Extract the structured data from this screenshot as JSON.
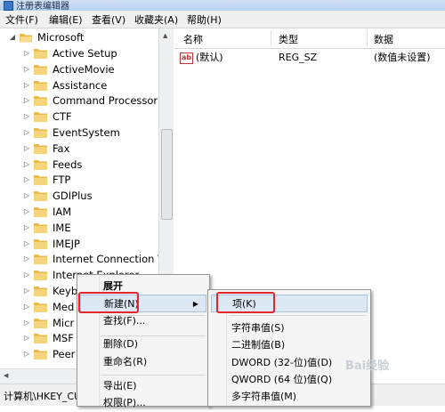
{
  "window": {
    "title": "注册表编辑器"
  },
  "menubar": [
    "文件(F)",
    "编辑(E)",
    "查看(V)",
    "收藏夹(A)",
    "帮助(H)"
  ],
  "tree": {
    "root": "Microsoft",
    "items": [
      "Active Setup",
      "ActiveMovie",
      "Assistance",
      "Command Processor",
      "CTF",
      "EventSystem",
      "Fax",
      "Feeds",
      "FTP",
      "GDIPlus",
      "IAM",
      "IME",
      "IMEJP",
      "Internet Connection W",
      "Internet Explorer",
      "Keyb",
      "Med",
      "Micr",
      "MSF",
      "Peer"
    ]
  },
  "columns": {
    "name": "名称",
    "type": "类型",
    "data": "数据"
  },
  "values": [
    {
      "name": "(默认)",
      "type": "REG_SZ",
      "data": "(数值未设置)"
    }
  ],
  "context_menu": {
    "items": [
      "展开",
      "新建(N)",
      "查找(F)...",
      "删除(D)",
      "重命名(R)",
      "导出(E)",
      "权限(P)..."
    ]
  },
  "submenu": {
    "items": [
      "项(K)",
      "字符串值(S)",
      "二进制值(B)",
      "DWORD (32-位)值(D)",
      "QWORD (64 位)值(Q)",
      "多字符串值(M)"
    ]
  },
  "statusbar": {
    "path": "计算机\\HKEY_CU"
  },
  "watermark": "Bai经验",
  "colors": {
    "highlight": "#e3262b",
    "folder": "#f3cf6b"
  }
}
